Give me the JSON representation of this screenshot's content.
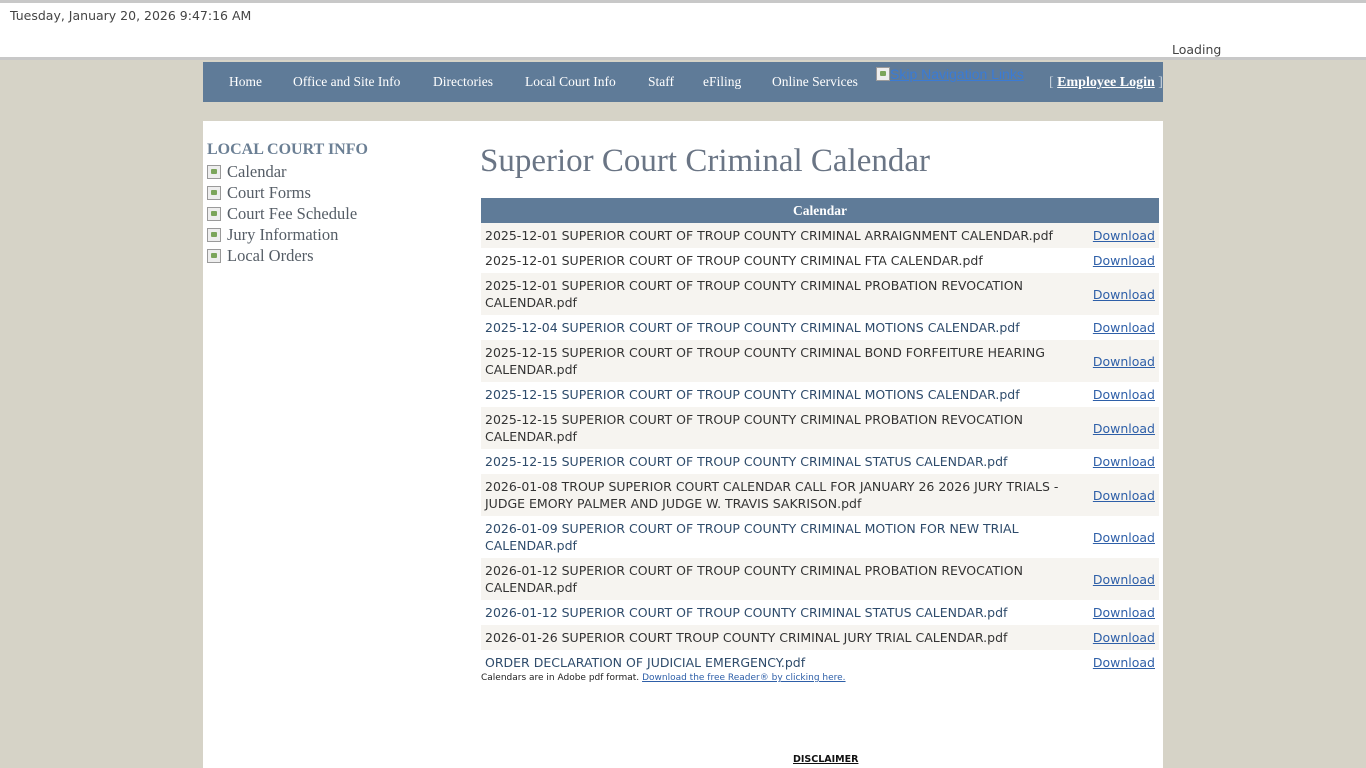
{
  "header": {
    "datetime": "Tuesday, January 20, 2026 9:47:16 AM",
    "loading": "Loading"
  },
  "nav": {
    "items": [
      {
        "label": "Home"
      },
      {
        "label": "Office and Site Info"
      },
      {
        "label": "Directories"
      },
      {
        "label": "Local Court Info"
      },
      {
        "label": "Staff"
      },
      {
        "label": "eFiling"
      },
      {
        "label": "Online Services"
      }
    ],
    "skip_link": "Skip Navigation Links",
    "login_bracket_open": "[",
    "login_label": "Employee Login",
    "login_bracket_close": "]"
  },
  "sidebar": {
    "title": "LOCAL COURT INFO",
    "items": [
      {
        "label": "Calendar"
      },
      {
        "label": "Court Forms"
      },
      {
        "label": "Court Fee Schedule"
      },
      {
        "label": "Jury Information"
      },
      {
        "label": "Local Orders"
      }
    ]
  },
  "main": {
    "title": "Superior Court Criminal Calendar",
    "table_header": "Calendar",
    "download_label": "Download",
    "rows": [
      {
        "name": "2025-12-01 SUPERIOR COURT OF TROUP COUNTY CRIMINAL ARRAIGNMENT CALENDAR.pdf"
      },
      {
        "name": "2025-12-01 SUPERIOR COURT OF TROUP COUNTY CRIMINAL FTA CALENDAR.pdf"
      },
      {
        "name": "2025-12-01 SUPERIOR COURT OF TROUP COUNTY CRIMINAL PROBATION REVOCATION CALENDAR.pdf"
      },
      {
        "name": "2025-12-04 SUPERIOR COURT OF TROUP COUNTY CRIMINAL MOTIONS CALENDAR.pdf"
      },
      {
        "name": "2025-12-15 SUPERIOR COURT OF TROUP COUNTY CRIMINAL BOND FORFEITURE HEARING CALENDAR.pdf"
      },
      {
        "name": "2025-12-15 SUPERIOR COURT OF TROUP COUNTY CRIMINAL MOTIONS CALENDAR.pdf"
      },
      {
        "name": "2025-12-15 SUPERIOR COURT OF TROUP COUNTY CRIMINAL PROBATION REVOCATION CALENDAR.pdf"
      },
      {
        "name": "2025-12-15 SUPERIOR COURT OF TROUP COUNTY CRIMINAL STATUS CALENDAR.pdf"
      },
      {
        "name": "2026-01-08 TROUP SUPERIOR COURT CALENDAR CALL FOR JANUARY 26 2026 JURY TRIALS - JUDGE EMORY PALMER AND JUDGE W. TRAVIS SAKRISON.pdf"
      },
      {
        "name": "2026-01-09 SUPERIOR COURT OF TROUP COUNTY CRIMINAL MOTION FOR NEW TRIAL CALENDAR.pdf"
      },
      {
        "name": "2026-01-12 SUPERIOR COURT OF TROUP COUNTY CRIMINAL PROBATION REVOCATION CALENDAR.pdf"
      },
      {
        "name": "2026-01-12 SUPERIOR COURT OF TROUP COUNTY CRIMINAL STATUS CALENDAR.pdf"
      },
      {
        "name": "2026-01-26 SUPERIOR COURT TROUP COUNTY CRIMINAL JURY TRIAL CALENDAR.pdf"
      },
      {
        "name": "ORDER DECLARATION OF JUDICIAL EMERGENCY.pdf"
      }
    ],
    "reader_note": "Calendars are in Adobe pdf format.",
    "reader_link": "Download the free Reader® by clicking here.",
    "disclaimer": "DISCLAIMER"
  },
  "colors": {
    "nav_bg": "#5f7b98",
    "page_bg": "#d6d3c7",
    "link": "#2e5fa8"
  }
}
